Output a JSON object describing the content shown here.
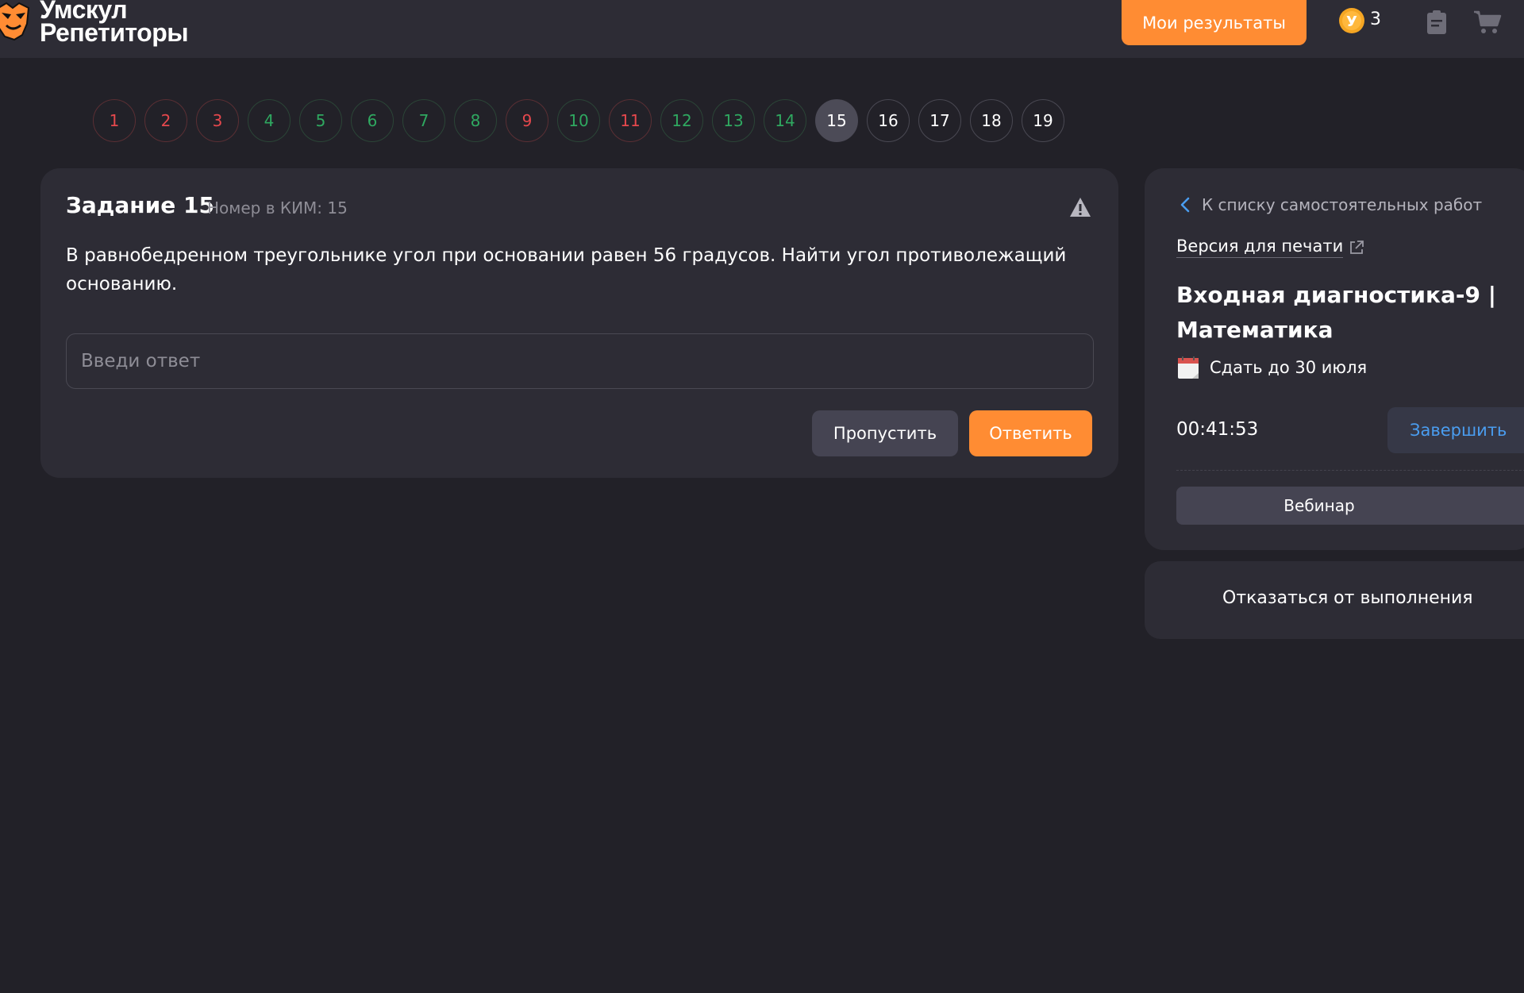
{
  "header": {
    "logo_line1": "Умскул",
    "logo_line2": "Репетиторы",
    "results_label": "Мои результаты",
    "coin_letter": "У",
    "coin_count": "3",
    "icons": [
      "coin-icon",
      "clipboard-icon",
      "cart-icon"
    ]
  },
  "task_nav": {
    "items": [
      {
        "label": "1",
        "status": "red"
      },
      {
        "label": "2",
        "status": "red"
      },
      {
        "label": "3",
        "status": "red"
      },
      {
        "label": "4",
        "status": "green"
      },
      {
        "label": "5",
        "status": "green"
      },
      {
        "label": "6",
        "status": "green"
      },
      {
        "label": "7",
        "status": "green"
      },
      {
        "label": "8",
        "status": "green"
      },
      {
        "label": "9",
        "status": "red"
      },
      {
        "label": "10",
        "status": "green"
      },
      {
        "label": "11",
        "status": "red"
      },
      {
        "label": "12",
        "status": "green"
      },
      {
        "label": "13",
        "status": "green"
      },
      {
        "label": "14",
        "status": "green"
      },
      {
        "label": "15",
        "status": "active"
      },
      {
        "label": "16",
        "status": "white"
      },
      {
        "label": "17",
        "status": "white"
      },
      {
        "label": "18",
        "status": "white"
      },
      {
        "label": "19",
        "status": "white"
      }
    ]
  },
  "task": {
    "title": "Задание 15",
    "kim": "Номер в КИМ: 15",
    "text": "В равнобедренном треугольнике угол при основании равен 56 градусов. Найти угол противолежащий основанию.",
    "input_placeholder": "Введи ответ",
    "input_value": "",
    "skip_label": "Пропустить",
    "answer_label": "Ответить"
  },
  "sidebar": {
    "back_label": "К списку самостоятельных работ",
    "print_label": "Версия для печати",
    "work_title": "Входная диагностика-9 | Математика",
    "deadline": "Сдать до 30 июля",
    "timer": "00:41:53",
    "finish_label": "Завершить",
    "webinar_label": "Вебинар",
    "refuse_label": "Отказаться от выполнения"
  },
  "colors": {
    "accent_orange": "#ff8c33",
    "error_red": "#e5484d",
    "success_green": "#2fa860",
    "link_blue": "#4a9df0",
    "background": "#222128",
    "card": "#2d2c35"
  }
}
